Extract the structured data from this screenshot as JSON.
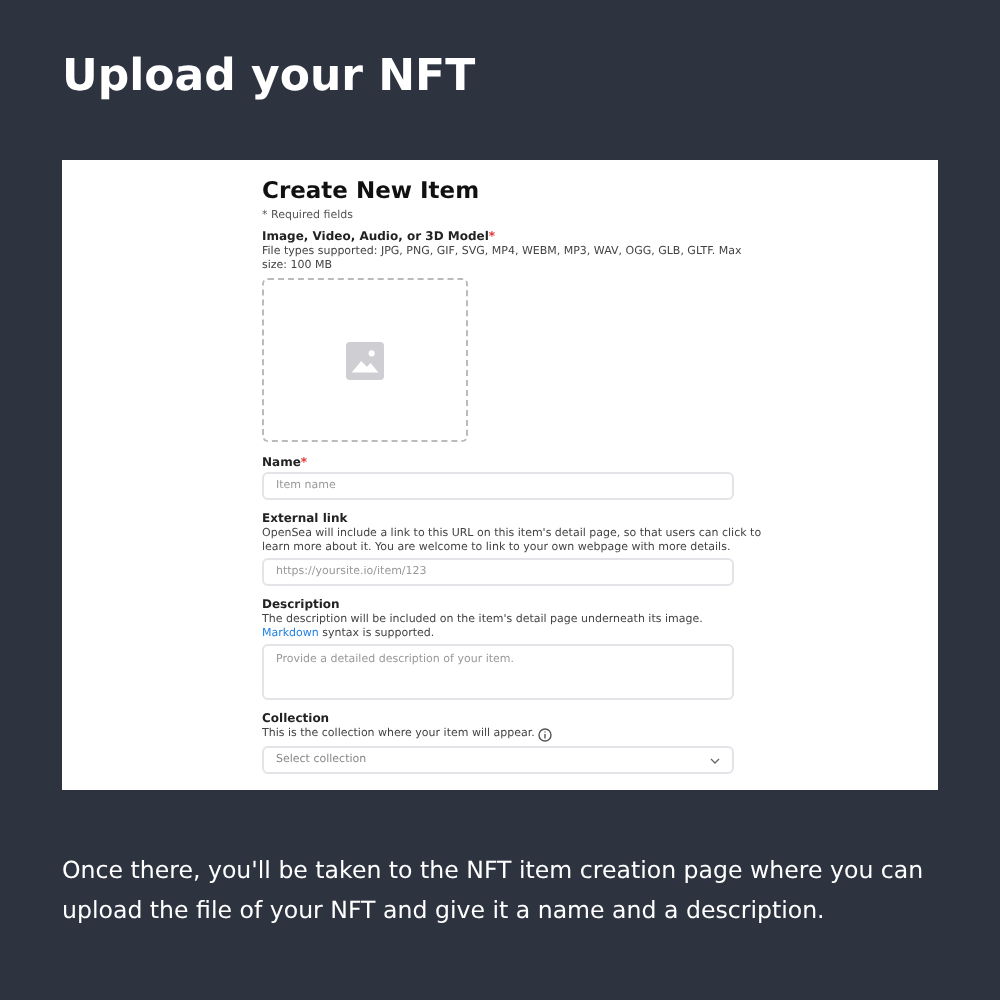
{
  "title": "Upload your NFT",
  "form": {
    "required_mark": "*",
    "heading": "Create New Item",
    "required_note": "* Required fields",
    "media": {
      "label": "Image, Video, Audio, or 3D Model",
      "required": true,
      "help": "File types supported: JPG, PNG, GIF, SVG, MP4, WEBM, MP3, WAV, OGG, GLB, GLTF. Max size: 100 MB"
    },
    "fields": [
      {
        "kind": "input",
        "label": "Name",
        "required": true,
        "placeholder": "Item name"
      },
      {
        "kind": "input",
        "label": "External link",
        "required": false,
        "help": "OpenSea will include a link to this URL on this item's detail page, so that users can click to learn more about it. You are welcome to link to your own webpage with more details.",
        "placeholder": "https://yoursite.io/item/123"
      },
      {
        "kind": "textarea",
        "label": "Description",
        "required": false,
        "help_before": "The description will be included on the item's detail page underneath its image.",
        "help_link": "Markdown",
        "help_after": "syntax is supported.",
        "placeholder": "Provide a detailed description of your item."
      },
      {
        "kind": "select",
        "label": "Collection",
        "required": false,
        "help": "This is the collection where your item will appear.",
        "info": true,
        "placeholder": "Select collection"
      }
    ]
  },
  "caption": "Once there, you'll be taken to the NFT item creation page where you can upload the file of your NFT and give it a name and a description."
}
